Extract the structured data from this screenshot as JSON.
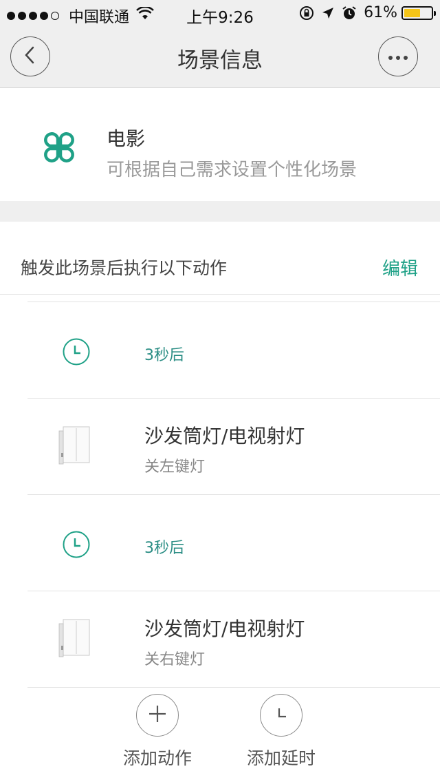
{
  "status_bar": {
    "carrier": "中国联通",
    "time": "上午9:26",
    "battery_percent": "61%",
    "battery_level": 0.61,
    "signal_bars_filled": 4,
    "icons": [
      "wifi-icon",
      "rotation-lock-icon",
      "location-icon",
      "alarm-icon"
    ]
  },
  "nav": {
    "title": "场景信息",
    "back_icon": "chevron-left-icon",
    "more_icon": "ellipsis-icon"
  },
  "scene": {
    "name": "电影",
    "description": "可根据自己需求设置个性化场景",
    "icon": "clover-scene-icon",
    "accent_color": "#1fa187"
  },
  "actions_section": {
    "title": "触发此场景后执行以下动作",
    "edit_label": "编辑"
  },
  "actions": [
    {
      "type": "delay",
      "label": "3秒后",
      "icon": "clock-icon"
    },
    {
      "type": "device",
      "name": "沙发筒灯/电视射灯",
      "detail": "关左键灯",
      "icon": "wall-switch-image"
    },
    {
      "type": "delay",
      "label": "3秒后",
      "icon": "clock-icon"
    },
    {
      "type": "device",
      "name": "沙发筒灯/电视射灯",
      "detail": "关右键灯",
      "icon": "wall-switch-image"
    }
  ],
  "bottom_bar": {
    "add_action_label": "添加动作",
    "add_action_icon": "plus-icon",
    "add_delay_label": "添加延时",
    "add_delay_icon": "clock-icon"
  }
}
